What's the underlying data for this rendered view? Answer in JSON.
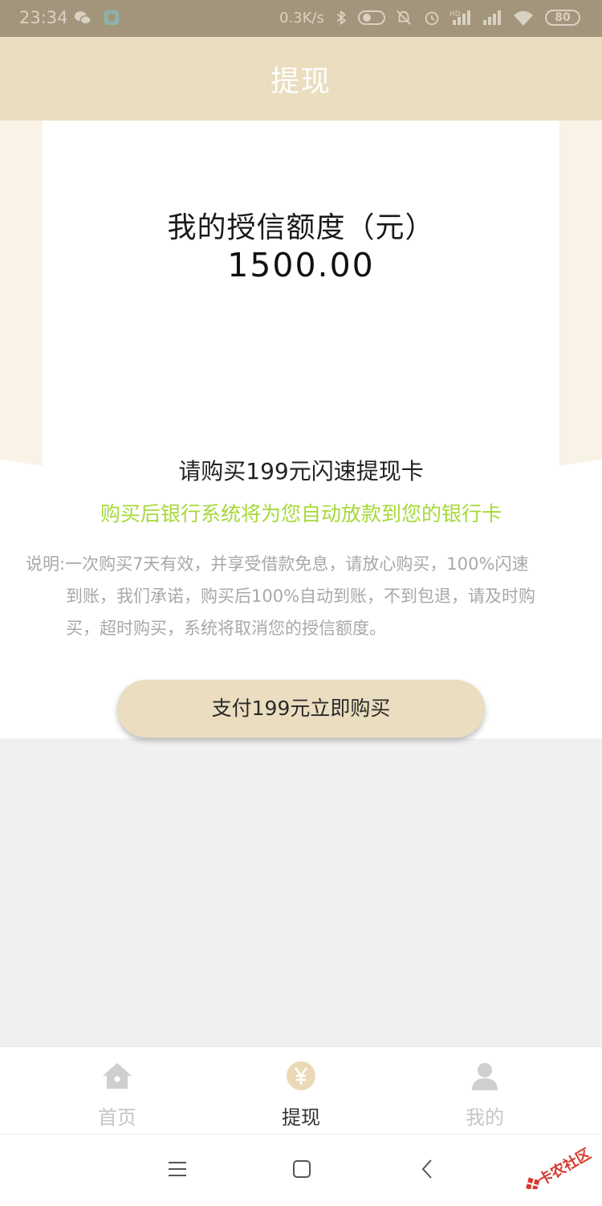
{
  "status_bar": {
    "time": "23:34",
    "network_speed": "0.3K/s",
    "battery": "80",
    "icons": [
      "wechat-icon",
      "shield-icon",
      "bluetooth-icon",
      "toggle-icon",
      "bell-off-icon",
      "alarm-icon",
      "hd-signal-icon",
      "signal-icon",
      "wifi-icon",
      "battery-icon"
    ]
  },
  "header": {
    "title": "提现"
  },
  "credit": {
    "label": "我的授信额度（元）",
    "amount": "1500.00"
  },
  "purchase": {
    "prompt": "请购买199元闪速提现卡",
    "note": "购买后银行系统将为您自动放款到您的银行卡",
    "explanation_lines": [
      "说明:一次购买7天有效，并享受借款免息，请放心购买，100%闪速",
      "到账，我们承诺，购买后100%自动到账，不到包退，请及时购",
      "买，超时购买，系统将取消您的授信额度。"
    ],
    "button_label": "支付199元立即购买"
  },
  "tabs": [
    {
      "label": "首页",
      "icon": "home-icon",
      "active": false
    },
    {
      "label": "提现",
      "icon": "yen-icon",
      "active": true
    },
    {
      "label": "我的",
      "icon": "user-icon",
      "active": false
    }
  ],
  "watermark": {
    "text": "卡农社区"
  },
  "colors": {
    "accent": "#eaddc0",
    "green_note": "#a6d93a",
    "status_bar": "#a2957c",
    "background": "#f0f0f0"
  }
}
